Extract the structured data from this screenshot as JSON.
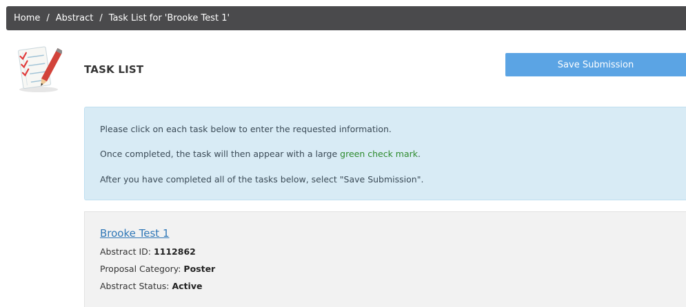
{
  "breadcrumb": {
    "items": [
      "Home",
      "Abstract",
      "Task List for 'Brooke Test 1'"
    ],
    "separator": "/"
  },
  "header": {
    "title": "TASK LIST",
    "save_label": "Save Submission"
  },
  "info": {
    "line1": "Please click on each task below to enter the requested information.",
    "line2_before": "Once completed, the task will then appear with a large ",
    "line2_highlight": "green check mark",
    "line2_after": ".",
    "line3": "After you have completed all of the tasks below, select \"Save Submission\"."
  },
  "abstract": {
    "title": "Brooke Test 1",
    "id_label": "Abstract ID: ",
    "id_value": "1112862",
    "category_label": "Proposal Category: ",
    "category_value": "Poster",
    "status_label": "Abstract Status: ",
    "status_value": "Active"
  },
  "colors": {
    "breadcrumb_bg": "#4a4a4c",
    "button_bg": "#5ba4e4",
    "info_bg": "#d8ebf5",
    "highlight_green": "#2d8a2d",
    "link_blue": "#2f77b7"
  },
  "icons": {
    "task_list": "checklist-pencil-icon"
  }
}
